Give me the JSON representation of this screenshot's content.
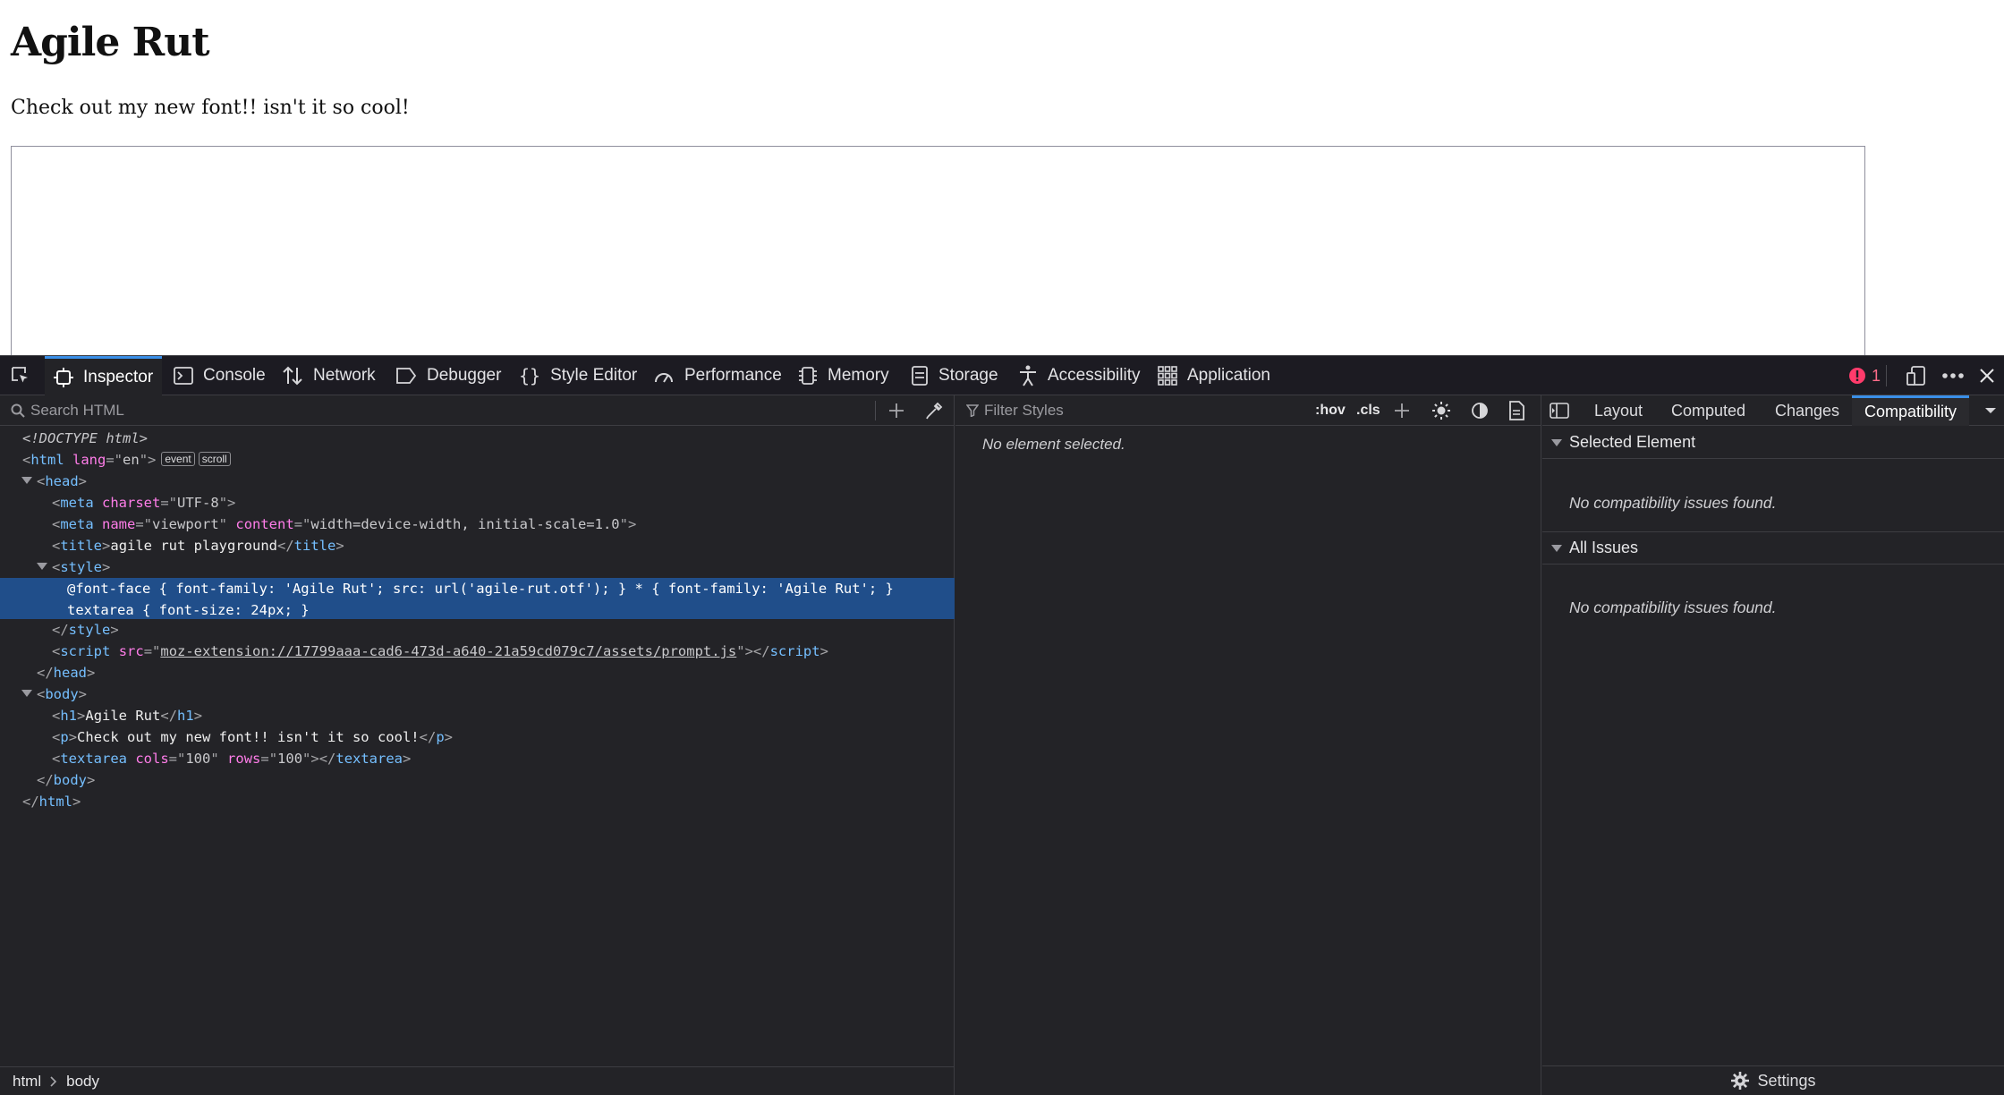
{
  "page": {
    "heading": "Agile Rut",
    "paragraph": "Check out my new font!! isn't it so cool!"
  },
  "devtools": {
    "tabs": [
      {
        "label": "Inspector",
        "icon": "inspector-icon"
      },
      {
        "label": "Console",
        "icon": "console-icon"
      },
      {
        "label": "Network",
        "icon": "network-icon"
      },
      {
        "label": "Debugger",
        "icon": "debugger-icon"
      },
      {
        "label": "Style Editor",
        "icon": "style-editor-icon"
      },
      {
        "label": "Performance",
        "icon": "performance-icon"
      },
      {
        "label": "Memory",
        "icon": "memory-icon"
      },
      {
        "label": "Storage",
        "icon": "storage-icon"
      },
      {
        "label": "Accessibility",
        "icon": "accessibility-icon"
      },
      {
        "label": "Application",
        "icon": "application-icon"
      }
    ],
    "error_count": "1",
    "colors": {
      "accent": "#3a8fe8",
      "error": "#ff3b6b",
      "selection": "#204e8a"
    }
  },
  "inspector": {
    "search_placeholder": "Search HTML",
    "markup": {
      "doctype": "<!DOCTYPE html>",
      "html_lang_val": "en",
      "badge_event": "event",
      "badge_scroll": "scroll",
      "meta_charset_val": "UTF-8",
      "meta_name_val": "viewport",
      "meta_content_val": "width=device-width, initial-scale=1.0",
      "title_text": "agile rut playground",
      "style_line1": "@font-face { font-family: 'Agile Rut'; src: url('agile-rut.otf'); } * { font-family: 'Agile Rut'; }",
      "style_line2": "textarea { font-size: 24px; }",
      "script_src": "moz-extension://17799aaa-cad6-473d-a640-21a59cd079c7/assets/prompt.js",
      "h1_text": "Agile Rut",
      "p_text": "Check out my new font!! isn't it so cool!",
      "textarea_cols": "100",
      "textarea_rows": "100"
    },
    "breadcrumbs": [
      "html",
      "body"
    ]
  },
  "rules": {
    "filter_placeholder": "Filter Styles",
    "hov": ":hov",
    "cls": ".cls",
    "empty_message": "No element selected."
  },
  "sidebar": {
    "tabs": [
      "Layout",
      "Computed",
      "Changes",
      "Compatibility"
    ],
    "active_tab": "Compatibility",
    "sections": [
      {
        "title": "Selected Element",
        "message": "No compatibility issues found."
      },
      {
        "title": "All Issues",
        "message": "No compatibility issues found."
      }
    ],
    "settings_label": "Settings"
  }
}
